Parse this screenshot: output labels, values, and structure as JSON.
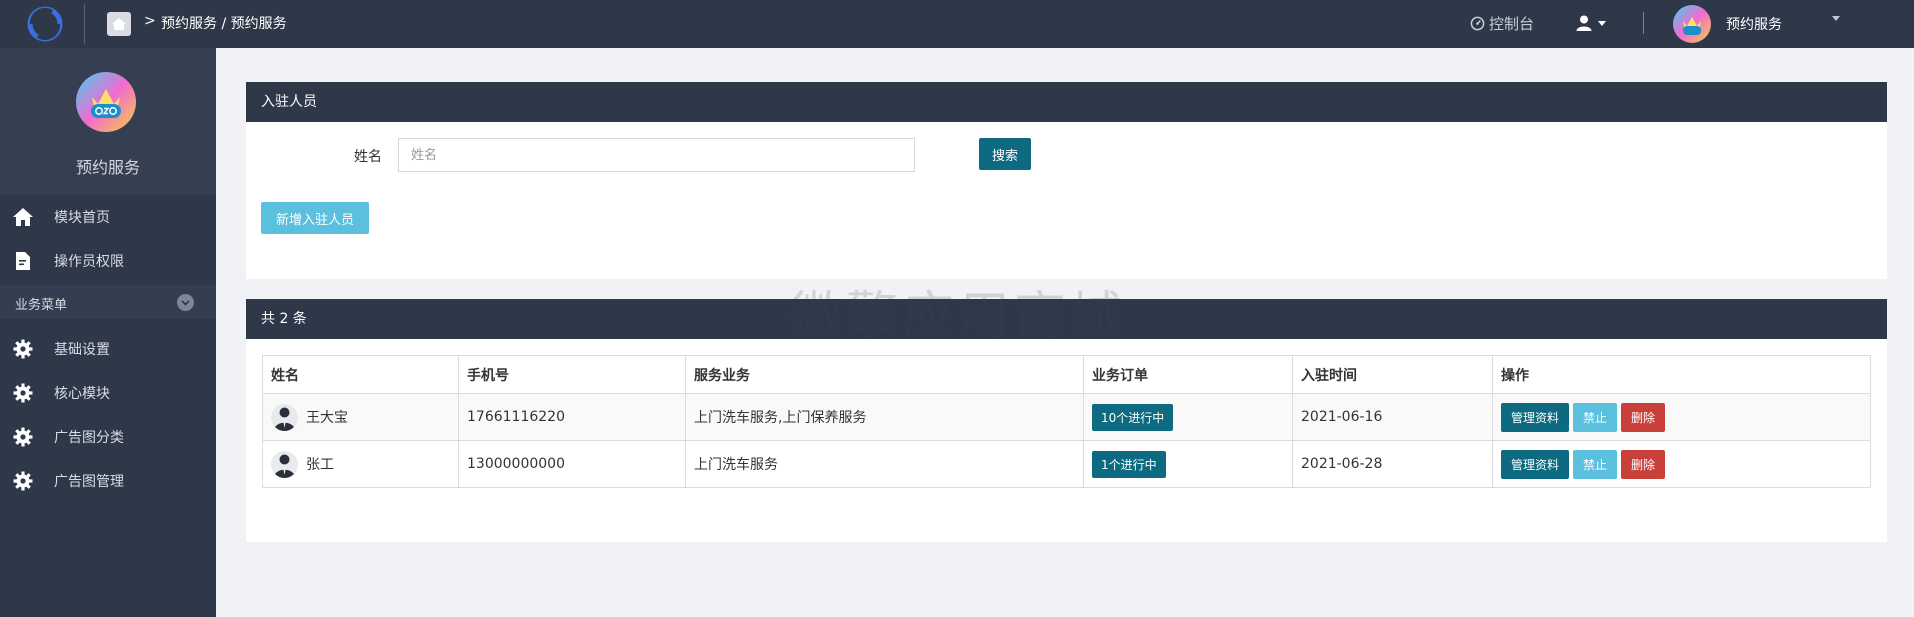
{
  "header": {
    "breadcrumb": "预约服务 / 预约服务",
    "console_label": "控制台",
    "account_name": "预约服务"
  },
  "sidebar": {
    "brand_title": "预约服务",
    "items_top": [
      {
        "label": "模块首页",
        "icon": "home-icon"
      },
      {
        "label": "操作员权限",
        "icon": "document-icon"
      }
    ],
    "section_label": "业务菜单",
    "items": [
      {
        "label": "基础设置",
        "icon": "gear-icon"
      },
      {
        "label": "核心模块",
        "icon": "gear-icon"
      },
      {
        "label": "广告图分类",
        "icon": "gear-icon"
      },
      {
        "label": "广告图管理",
        "icon": "gear-icon"
      }
    ]
  },
  "filter_panel": {
    "title": "入驻人员",
    "name_label": "姓名",
    "name_placeholder": "姓名",
    "name_value": "",
    "search_label": "搜索",
    "add_label": "新增入驻人员"
  },
  "watermark": "微擎应用商城",
  "list_panel": {
    "title": "共 2 条",
    "columns": [
      "姓名",
      "手机号",
      "服务业务",
      "业务订单",
      "入驻时间",
      "操作"
    ],
    "rows": [
      {
        "name": "王大宝",
        "phone": "17661116220",
        "services": "上门洗车服务,上门保养服务",
        "orders": "10个进行中",
        "date": "2021-06-16"
      },
      {
        "name": "张工",
        "phone": "13000000000",
        "services": "上门洗车服务",
        "orders": "1个进行中",
        "date": "2021-06-28"
      }
    ],
    "actions": {
      "manage": "管理资料",
      "ban": "禁止",
      "delete": "删除"
    }
  },
  "colors": {
    "topbar": "#2e3849",
    "primary": "#0e6a80",
    "info": "#5bc0de",
    "danger": "#c9403a",
    "background": "#f0f2f5"
  }
}
